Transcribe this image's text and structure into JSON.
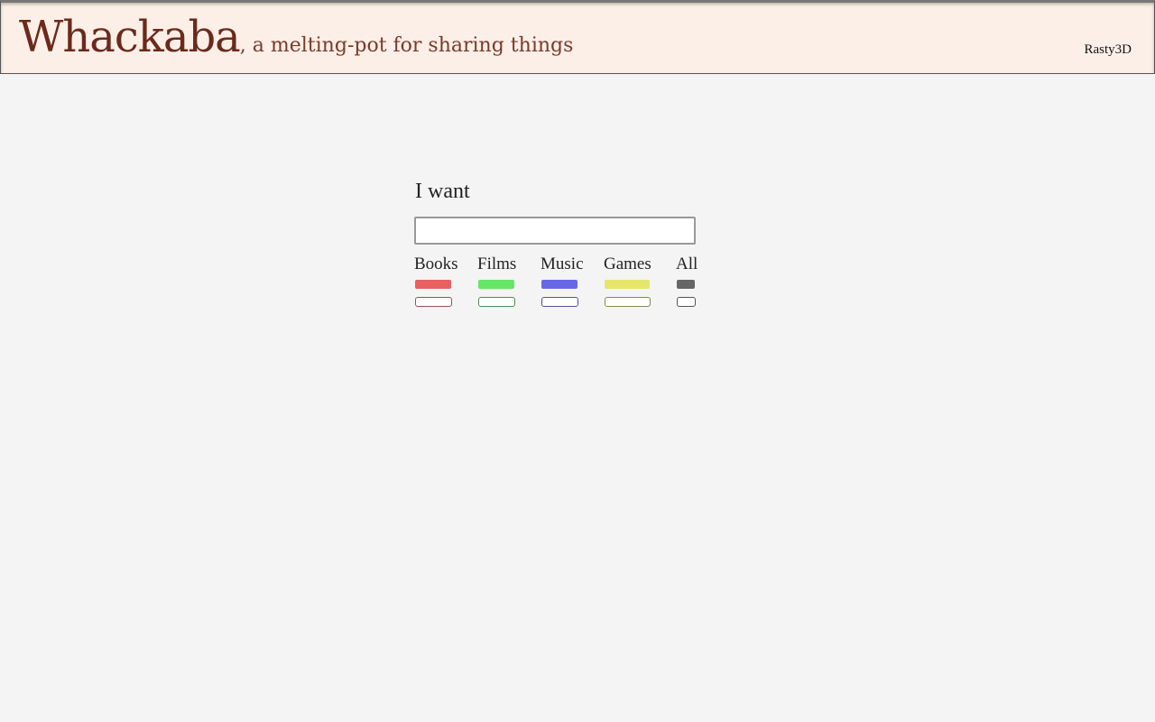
{
  "header": {
    "brand_name": "Whackaba",
    "tagline": ", a melting-pot for sharing things",
    "user": "Rasty3D"
  },
  "search": {
    "label": "I want",
    "value": "",
    "placeholder": ""
  },
  "categories": [
    {
      "label": "Books",
      "fill_color": "#e86060",
      "outline_color": "#905555"
    },
    {
      "label": "Films",
      "fill_color": "#66e666",
      "outline_color": "#558855"
    },
    {
      "label": "Music",
      "fill_color": "#6868e6",
      "outline_color": "#555585"
    },
    {
      "label": "Games",
      "fill_color": "#e6e66a",
      "outline_color": "#888855"
    },
    {
      "label": "All",
      "fill_color": "#666666",
      "outline_color": "#555555"
    }
  ]
}
